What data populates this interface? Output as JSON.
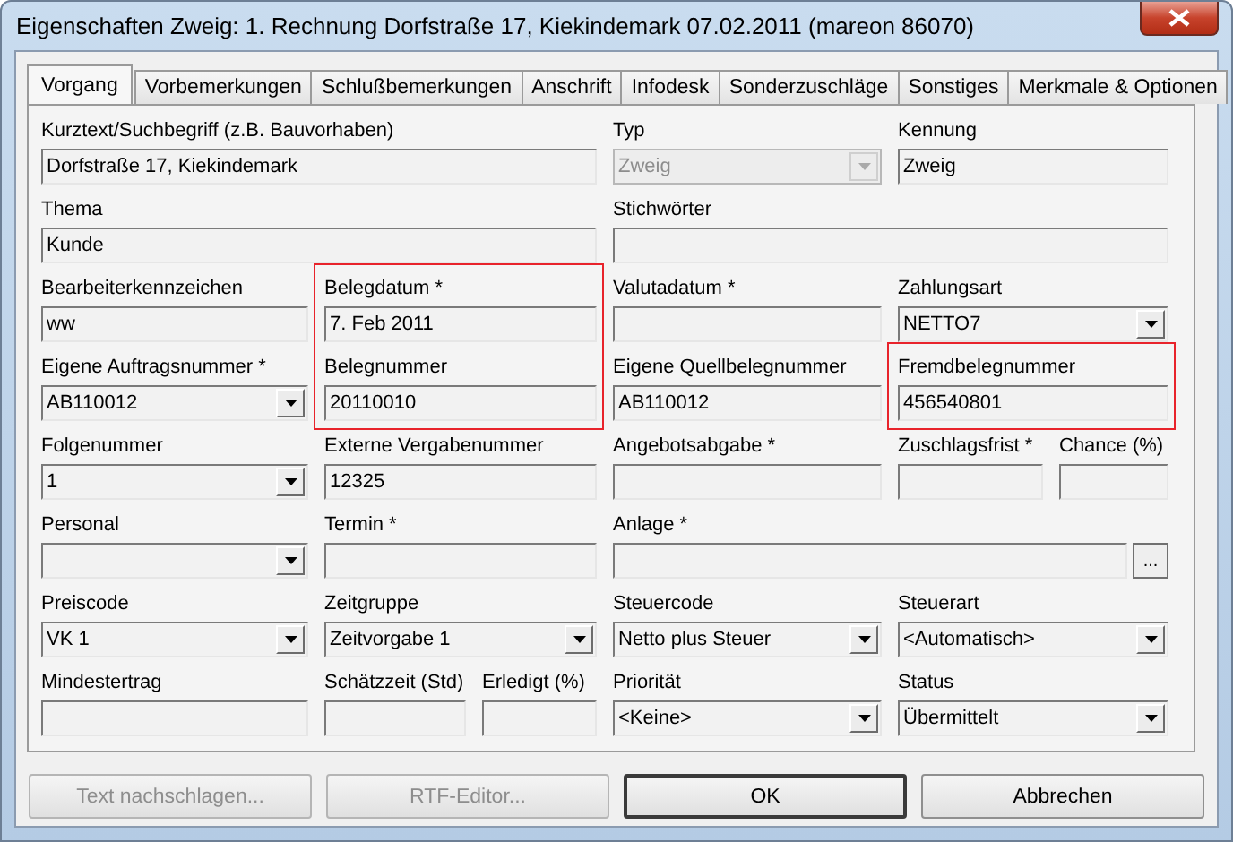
{
  "window": {
    "title": "Eigenschaften Zweig: 1. Rechnung Dorfstraße 17, Kiekindemark 07.02.2011 (mareon 86070)"
  },
  "tabs": [
    {
      "label": "Vorgang",
      "selected": true
    },
    {
      "label": "Vorbemerkungen",
      "selected": false
    },
    {
      "label": "Schlußbemerkungen",
      "selected": false
    },
    {
      "label": "Anschrift",
      "selected": false
    },
    {
      "label": "Infodesk",
      "selected": false
    },
    {
      "label": "Sonderzuschläge",
      "selected": false
    },
    {
      "label": "Sonstiges",
      "selected": false
    },
    {
      "label": "Merkmale & Optionen",
      "selected": false
    }
  ],
  "rows": [
    [
      {
        "label": "Kurztext/Suchbegriff (z.B. Bauvorhaben)",
        "kind": "text",
        "value": "Dorfstraße 17, Kiekindemark",
        "disabled": false,
        "highlighted": false
      },
      {
        "label": "Typ",
        "kind": "dropdown",
        "value": "Zweig",
        "disabled": true,
        "highlighted": false
      },
      {
        "label": "Kennung",
        "kind": "text",
        "value": "Zweig",
        "disabled": false,
        "highlighted": false
      }
    ],
    [
      {
        "label": "Thema",
        "kind": "text",
        "value": "Kunde",
        "disabled": false,
        "highlighted": false
      },
      {
        "label": "Stichwörter",
        "kind": "text",
        "disabled": false,
        "highlighted": false
      }
    ],
    [
      {
        "label": "Bearbeiterkennzeichen",
        "kind": "text",
        "value": "ww",
        "disabled": false,
        "highlighted": false
      },
      {
        "label": "Belegdatum *",
        "kind": "text",
        "value": "7. Feb 2011",
        "disabled": false,
        "highlighted": true
      },
      {
        "label": "Valutadatum *",
        "kind": "text",
        "disabled": false,
        "highlighted": false
      },
      {
        "label": "Zahlungsart",
        "kind": "dropdown",
        "value": "NETTO7",
        "disabled": false,
        "highlighted": false
      }
    ],
    [
      {
        "label": "Eigene Auftragsnummer *",
        "kind": "dropdown",
        "value": "AB110012",
        "disabled": false,
        "highlighted": false
      },
      {
        "label": "Belegnummer",
        "kind": "text",
        "value": "20110010",
        "disabled": false,
        "highlighted": true
      },
      {
        "label": "Eigene Quellbelegnummer",
        "kind": "text",
        "value": "AB110012",
        "disabled": false,
        "highlighted": false
      },
      {
        "label": "Fremdbelegnummer",
        "kind": "text",
        "value": "456540801",
        "disabled": false,
        "highlighted": true
      }
    ],
    [
      {
        "label": "Folgenummer",
        "kind": "dropdown",
        "value": "1",
        "disabled": false,
        "highlighted": false
      },
      {
        "label": "Externe Vergabenummer",
        "kind": "text",
        "value": "12325",
        "disabled": false,
        "highlighted": false
      },
      {
        "label": "Angebotsabgabe *",
        "kind": "text",
        "disabled": false,
        "highlighted": false
      },
      {
        "label": "Zuschlagsfrist *",
        "kind": "text",
        "disabled": false,
        "highlighted": false
      },
      {
        "label": "Chance (%)",
        "kind": "text",
        "disabled": false,
        "highlighted": false
      }
    ],
    [
      {
        "label": "Personal",
        "kind": "dropdown",
        "disabled": false,
        "highlighted": false
      },
      {
        "label": "Termin *",
        "kind": "text",
        "disabled": false,
        "highlighted": false
      },
      {
        "label": "Anlage *",
        "kind": "browse",
        "button": "...",
        "disabled": false,
        "highlighted": false
      }
    ],
    [
      {
        "label": "Preiscode",
        "kind": "dropdown",
        "value": "VK 1",
        "disabled": false,
        "highlighted": false
      },
      {
        "label": "Zeitgruppe",
        "kind": "dropdown",
        "value": "Zeitvorgabe 1",
        "disabled": false,
        "highlighted": false
      },
      {
        "label": "Steuercode",
        "kind": "dropdown",
        "value": "Netto plus Steuer",
        "disabled": false,
        "highlighted": false
      },
      {
        "label": "Steuerart",
        "kind": "dropdown",
        "value": "<Automatisch>",
        "disabled": false,
        "highlighted": false
      }
    ],
    [
      {
        "label": "Mindestertrag",
        "kind": "text",
        "disabled": false,
        "highlighted": false
      },
      {
        "label": "Schätzzeit (Std)",
        "kind": "text",
        "disabled": false,
        "highlighted": false
      },
      {
        "label": "Erledigt (%)",
        "kind": "text",
        "disabled": false,
        "highlighted": false
      },
      {
        "label": "Priorität",
        "kind": "dropdown",
        "value": "<Keine>",
        "disabled": false,
        "highlighted": false
      },
      {
        "label": "Status",
        "kind": "dropdown",
        "value": "Übermittelt",
        "disabled": false,
        "highlighted": false
      }
    ]
  ],
  "buttons": [
    {
      "label": "Text nachschlagen...",
      "disabled": true,
      "default": false
    },
    {
      "label": "RTF-Editor...",
      "disabled": true,
      "default": false
    },
    {
      "label": "OK",
      "disabled": false,
      "default": true
    },
    {
      "label": "Abbrechen",
      "disabled": false,
      "default": false
    }
  ]
}
